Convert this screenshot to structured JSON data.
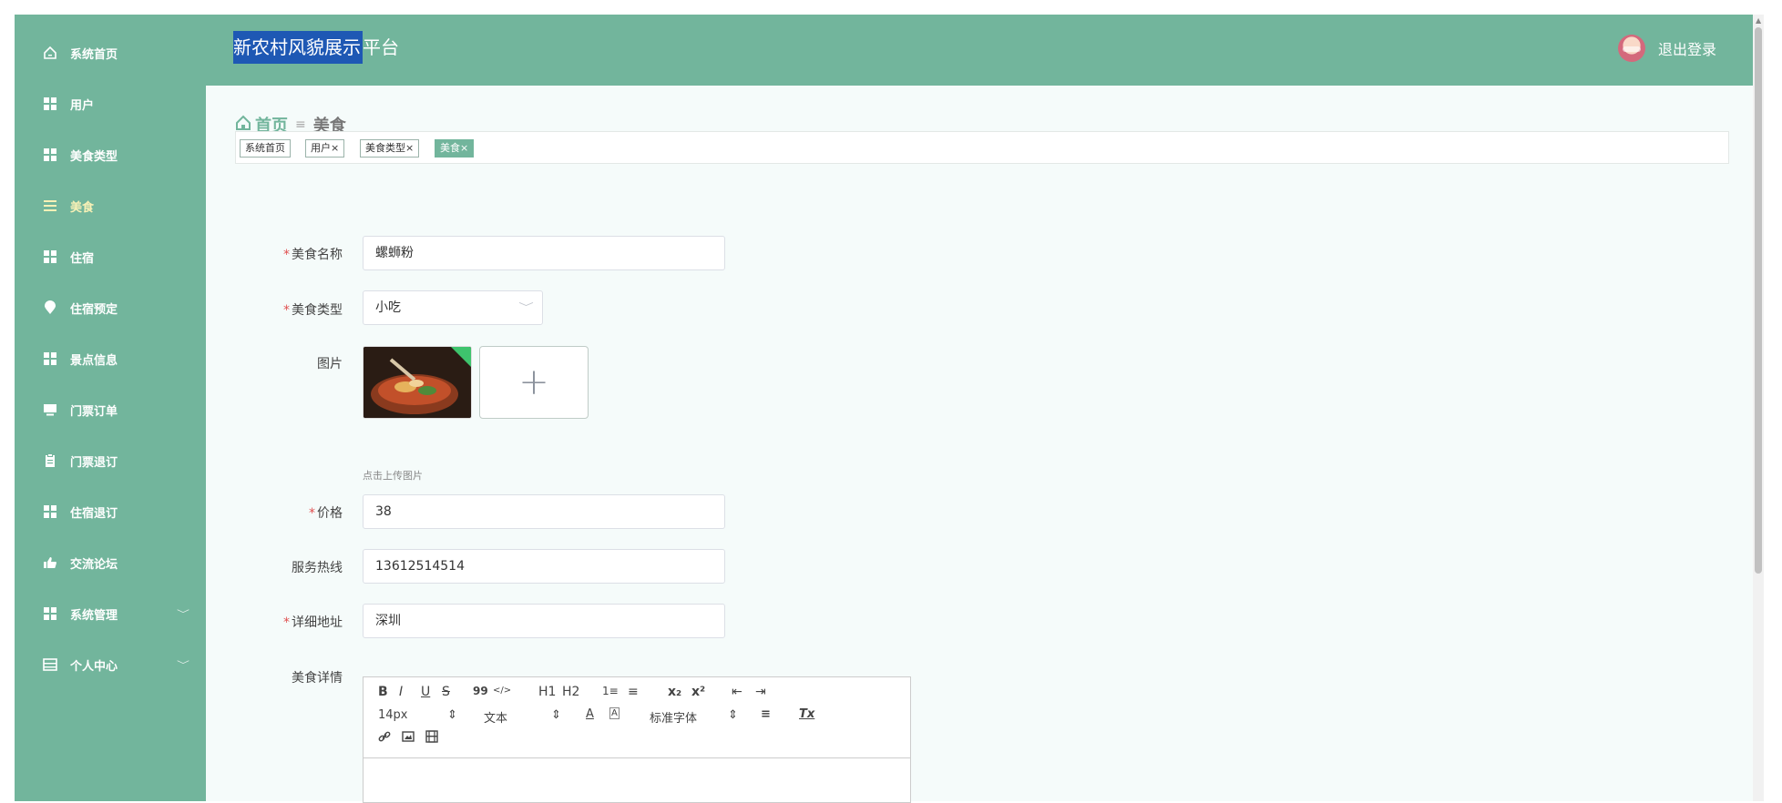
{
  "sidebar": {
    "items": [
      {
        "label": "系统首页",
        "icon": "home-icon"
      },
      {
        "label": "用户",
        "icon": "grid-icon"
      },
      {
        "label": "美食类型",
        "icon": "grid-icon"
      },
      {
        "label": "美食",
        "icon": "list-icon",
        "active": true
      },
      {
        "label": "住宿",
        "icon": "grid-icon"
      },
      {
        "label": "住宿预定",
        "icon": "location-pin-icon"
      },
      {
        "label": "景点信息",
        "icon": "grid-icon"
      },
      {
        "label": "门票订单",
        "icon": "monitor-icon"
      },
      {
        "label": "门票退订",
        "icon": "clipboard-icon"
      },
      {
        "label": "住宿退订",
        "icon": "grid-icon"
      },
      {
        "label": "交流论坛",
        "icon": "thumbs-up-icon"
      },
      {
        "label": "系统管理",
        "icon": "grid-icon",
        "expandable": true
      },
      {
        "label": "个人中心",
        "icon": "window-icon",
        "expandable": true
      }
    ],
    "expand_glyph": "﹀"
  },
  "header": {
    "title_selected": "新农村风貌展示",
    "title_rest": "平台",
    "logout_label": "退出登录"
  },
  "breadcrumb": {
    "home": "首页",
    "separator": "≡",
    "current": "美食"
  },
  "tags": [
    {
      "label": "系统首页"
    },
    {
      "label": "用户×"
    },
    {
      "label": "美食类型×"
    },
    {
      "label": "美食×",
      "active": true
    }
  ],
  "form": {
    "required_mark": "*",
    "name": {
      "label": "美食名称",
      "value": "螺蛳粉",
      "required": true
    },
    "type": {
      "label": "美食类型",
      "value": "小吃",
      "required": true,
      "chevron": "﹀"
    },
    "image": {
      "label": "图片",
      "add_glyph": "+",
      "hint": "点击上传图片"
    },
    "price": {
      "label": "价格",
      "value": "38",
      "required": true
    },
    "hotline": {
      "label": "服务热线",
      "value": "13612514514"
    },
    "address": {
      "label": "详细地址",
      "value": "深圳",
      "required": true
    },
    "detail": {
      "label": "美食详情"
    }
  },
  "editor": {
    "row1": [
      "B",
      "I",
      "U",
      "S",
      "99",
      "</>",
      "H1",
      "H2",
      "1≡",
      "≡",
      "x₂",
      "x²",
      "⇤",
      "⇥"
    ],
    "size": "14px",
    "format": "文本",
    "font": "标准字体",
    "picker_arrow": "⇕",
    "color_a": "A",
    "bg_a": "A",
    "align": "≡",
    "clear": "Tx",
    "row3": [
      "link-icon",
      "image-icon",
      "video-icon"
    ]
  },
  "colors": {
    "theme": "#72b59c",
    "active_menu_text": "#f8f1b6",
    "selection": "#1e58b4"
  }
}
